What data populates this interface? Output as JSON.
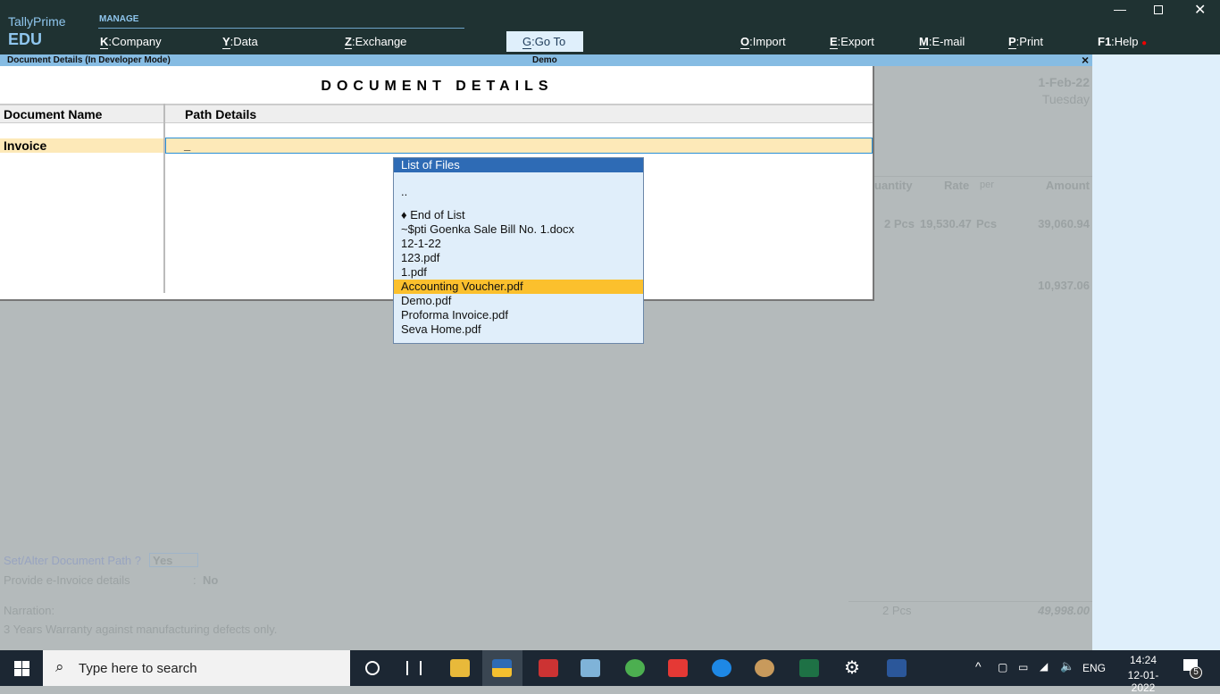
{
  "app": {
    "brand": "TallyPrime",
    "edition": "EDU",
    "section": "MANAGE"
  },
  "menu": [
    {
      "key": "K",
      "label": "Company"
    },
    {
      "key": "Y",
      "label": "Data"
    },
    {
      "key": "Z",
      "label": "Exchange"
    },
    {
      "key": "G",
      "label": "Go To"
    },
    {
      "key": "O",
      "label": "Import"
    },
    {
      "key": "E",
      "label": "Export"
    },
    {
      "key": "M",
      "label": "E-mail"
    },
    {
      "key": "P",
      "label": "Print"
    },
    {
      "key": "F1",
      "label": "Help"
    }
  ],
  "subbar": {
    "left": "Document Details (In Developer Mode)",
    "center": "Demo",
    "close": "×"
  },
  "dialog": {
    "title": "DOCUMENT DETAILS",
    "col1": "Document Name",
    "col2": "Path Details",
    "row_name": "Invoice",
    "row_path": "_"
  },
  "file_list": {
    "title": "List of Files",
    "items": [
      "..",
      "♦ End of List",
      "~$pti Goenka Sale Bill No. 1.docx",
      "12-1-22",
      "123.pdf",
      "1.pdf",
      "Accounting Voucher.pdf",
      "Demo.pdf",
      "Proforma Invoice.pdf",
      "Seva Home.pdf"
    ],
    "selected": "Accounting Voucher.pdf"
  },
  "background": {
    "date": "1-Feb-22",
    "day": "Tuesday",
    "h_qty": "uantity",
    "h_rate": "Rate",
    "h_per": "per",
    "h_amount": "Amount",
    "qty": "2 Pcs",
    "rate": "19,530.47",
    "per": "Pcs",
    "amount": "39,060.94",
    "amount2": "10,937.06",
    "set_path_label": "Set/Alter Document Path",
    "set_path_q": "?",
    "set_path_val": "Yes",
    "einv_label": "Provide e-Invoice details",
    "einv_colon": ":",
    "einv_val": "No",
    "narration_label": "Narration:",
    "narration": "3 Years Warranty against manufacturing defects only.",
    "total_qty": "2 Pcs",
    "total_amount": "49,998.00"
  },
  "taskbar": {
    "search_placeholder": "Type here to search",
    "time": "14:24",
    "date": "12-01-2022",
    "lang": "ENG",
    "notifications": "5"
  },
  "colors": {
    "topbar": "#1f3232",
    "subbar": "#86bce3",
    "selected": "#fbc02d",
    "list_header": "#2e6bb5",
    "active_row": "#fde9b8"
  }
}
